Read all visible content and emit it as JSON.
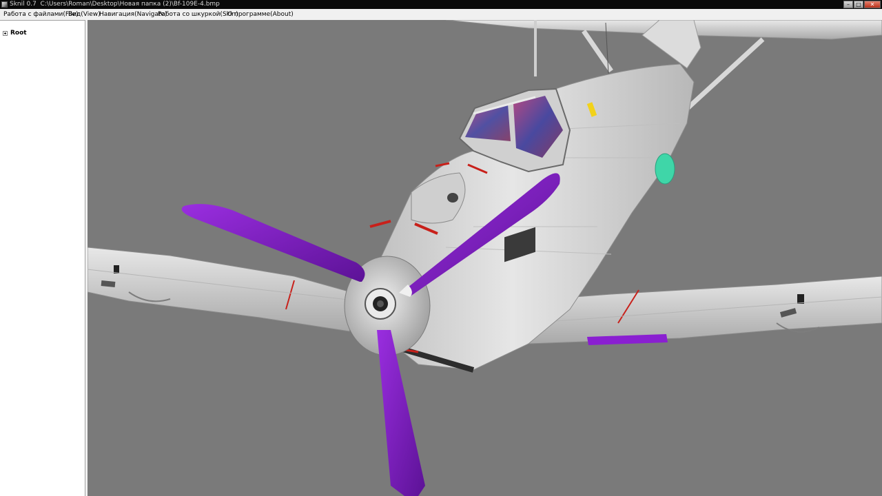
{
  "window": {
    "app_name": "Sknil 0.7",
    "file_path": "C:\\Users\\Roman\\Desktop\\Новая папка (2)\\Bf-109E-4.bmp",
    "buttons": {
      "minimize": "–",
      "maximize": "□",
      "close": "✕"
    }
  },
  "menu": {
    "items": [
      {
        "label": "Работа с файлами(File)"
      },
      {
        "label": "Вид(View)"
      },
      {
        "label": "Навигация(Navigate)"
      },
      {
        "label": "Работа со шкуркой(Skin)"
      },
      {
        "label": "О программе(About)"
      }
    ]
  },
  "tree": {
    "root_label": "Root",
    "expander_icon": "plus-box-icon"
  },
  "viewport": {
    "background": "#7a7a7a",
    "model": "Bf-109E-4",
    "colors": {
      "fuselage": "#dcdcdc",
      "propeller": "#8a1fd1",
      "propeller_dark": "#5c1296",
      "canopy_glass": "#8a2a6a",
      "marking_red": "#c8201a",
      "accent_teal": "#3fd6a8",
      "marking_yellow": "#f2d21a"
    }
  }
}
